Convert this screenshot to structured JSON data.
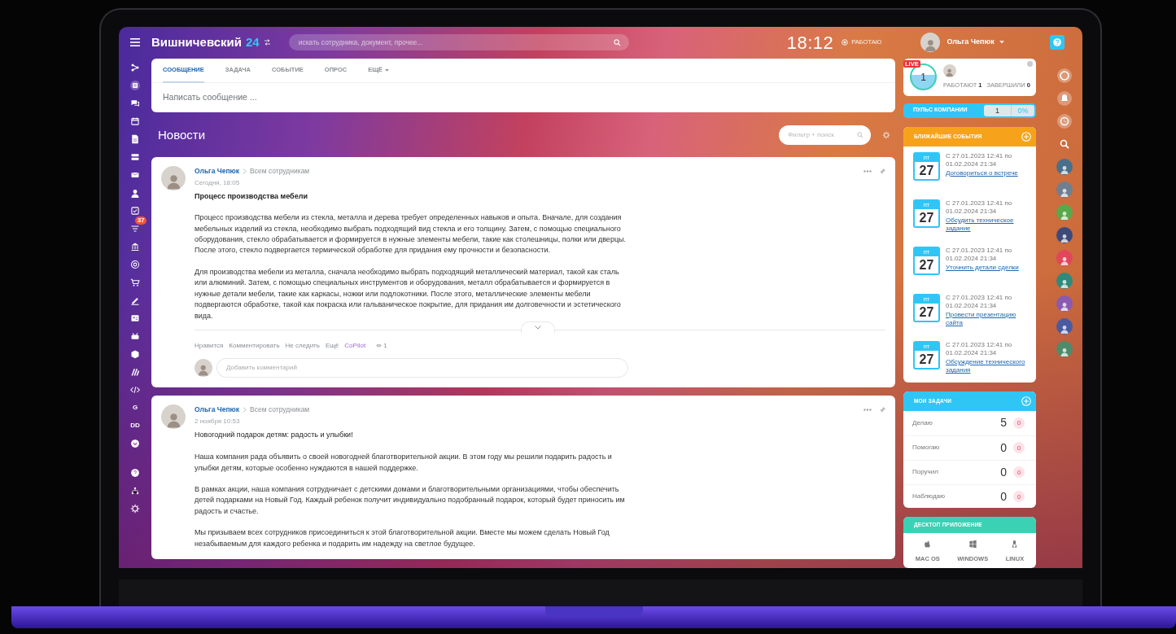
{
  "header": {
    "title": "Вишничевский",
    "title_number": "24",
    "search_placeholder": "искать сотрудника, документ, прочее...",
    "clock": "18:12",
    "status": "РАБОТАЮ",
    "user_name": "Ольга Чепюк"
  },
  "left_menu": {
    "badge": "37",
    "letter_items": [
      "G",
      "DD"
    ]
  },
  "composer": {
    "tabs": [
      {
        "label": "СООБЩЕНИЕ",
        "selected": true,
        "has_menu": false
      },
      {
        "label": "ЗАДАЧА",
        "selected": false,
        "has_menu": false
      },
      {
        "label": "СОБЫТИЕ",
        "selected": false,
        "has_menu": false
      },
      {
        "label": "ОПРОС",
        "selected": false,
        "has_menu": false
      },
      {
        "label": "ЕЩЁ",
        "selected": false,
        "has_menu": true
      }
    ],
    "placeholder": "Написать сообщение ..."
  },
  "feed": {
    "title": "Новости",
    "filter_placeholder": "Фильтр + поиск"
  },
  "posts": [
    {
      "author": "Ольга Чепюк",
      "audience": "Всем сотрудникам",
      "time": "Сегодня, 18:05",
      "title": "Процесс производства мебели",
      "title_bold": true,
      "paragraphs": [
        "Процесс производства мебели из стекла, металла и дерева требует определенных навыков и опыта. Вначале, для создания мебельных изделий из стекла, необходимо выбрать подходящий вид стекла и его толщину. Затем, с помощью специального оборудования, стекло обрабатывается и формируется в нужные элементы мебели, такие как столешницы, полки или дверцы. После этого, стекло подвергается термической обработке для придания ему прочности и безопасности.",
        "Для производства мебели из металла, сначала необходимо выбрать подходящий металлический материал, такой как сталь или алюминий. Затем, с помощью специальных инструментов и оборудования, металл обрабатывается и формируется в нужные детали мебели, такие как каркасы, ножки или подлокотники. После этого, металлические элементы мебели подвергаются обработке, такой как покраска или гальваническое покрытие, для придания им долговечности и эстетического вида."
      ],
      "actions": [
        {
          "label": "Нравится",
          "kind": "link"
        },
        {
          "label": "Комментировать",
          "kind": "link"
        },
        {
          "label": "Не следить",
          "kind": "link"
        },
        {
          "label": "Ещё",
          "kind": "link"
        },
        {
          "label": "CoPilot",
          "kind": "copilot"
        }
      ],
      "views": "1",
      "comment_placeholder": "Добавить комментарий"
    },
    {
      "author": "Ольга Чепюк",
      "audience": "Всем сотрудникам",
      "time": "2 ноября 10:53",
      "title": "Новогодний подарок детям: радость и улыбки!",
      "title_bold": false,
      "paragraphs": [
        "Наша компания рада объявить о своей новогодней благотворительной акции. В этом году мы решили подарить радость и улыбки детям, которые особенно нуждаются в нашей поддержке.",
        "В рамках акции, наша компания сотрудничает с детскими домами и благотворительными организациями, чтобы обеспечить детей подарками на Новый Год. Каждый ребенок получит индивидуально подобранный подарок, который будет приносить им радость и счастье.",
        "Мы призываем всех сотрудников присоединиться к этой благотворительной акции. Вместе мы можем сделать Новый Год незабываемым для каждого ребенка и подарить им надежду на светлое будущее."
      ]
    }
  ],
  "work_day": {
    "live": "LIVE",
    "count": "1",
    "working": "РАБОТАЮТ **1**",
    "finished": "ЗАВЕРШИЛИ **0**"
  },
  "pulse": {
    "label": "ПУЛЬС КОМПАНИИ",
    "count": "1",
    "percent": "0%"
  },
  "events": {
    "title": "БЛИЖАЙШИЕ СОБЫТИЯ",
    "items": [
      {
        "weekday": "пт",
        "day": "27",
        "from": "С 27.01.2023 12:41 по",
        "to": "01.02.2024 21:34",
        "name": "Договориться о встрече"
      },
      {
        "weekday": "пт",
        "day": "27",
        "from": "С 27.01.2023 12:41 по",
        "to": "01.02.2024 21:34",
        "name": "Обсудить техническое задание"
      },
      {
        "weekday": "пт",
        "day": "27",
        "from": "С 27.01.2023 12:41 по",
        "to": "01.02.2024 21:34",
        "name": "Уточнить детали сделки"
      },
      {
        "weekday": "пт",
        "day": "27",
        "from": "С 27.01.2023 12:41 по",
        "to": "01.02.2024 21:34",
        "name": "Провести презентацию сайта"
      },
      {
        "weekday": "пт",
        "day": "27",
        "from": "С 27.01.2023 12:41 по",
        "to": "01.02.2024 21:34",
        "name": "Обсуждение технического задания"
      }
    ]
  },
  "tasks": {
    "title": "МОИ ЗАДАЧИ",
    "rows": [
      {
        "label": "Делаю",
        "count": "5",
        "badge": "0"
      },
      {
        "label": "Помогаю",
        "count": "0",
        "badge": "0"
      },
      {
        "label": "Поручил",
        "count": "0",
        "badge": "0"
      },
      {
        "label": "Наблюдаю",
        "count": "0",
        "badge": "0"
      }
    ]
  },
  "desktop_app": {
    "title": "ДЕСКТОП ПРИЛОЖЕНИЕ",
    "platforms": [
      {
        "kind": "apple",
        "label": "MAC OS"
      },
      {
        "kind": "windows",
        "label": "WINDOWS"
      },
      {
        "kind": "linux",
        "label": "LINUX"
      }
    ]
  }
}
